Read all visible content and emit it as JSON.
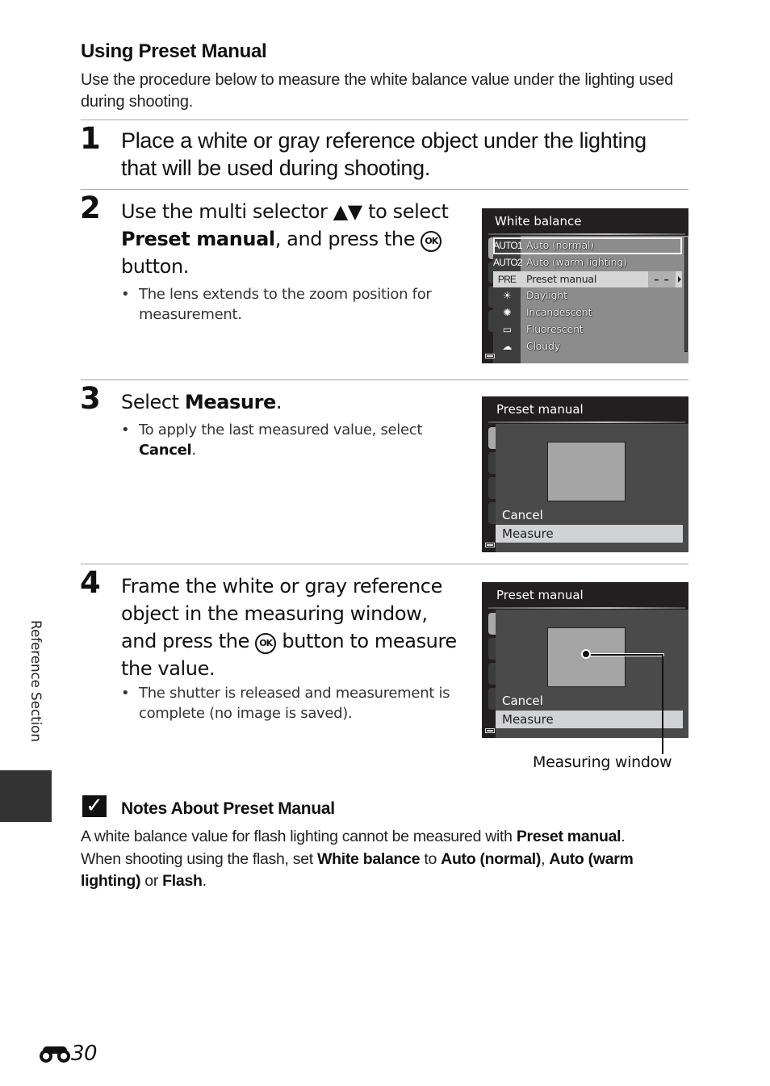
{
  "section": {
    "heading": "Using Preset Manual",
    "intro": "Use the procedure below to measure the white balance value under the lighting used during shooting."
  },
  "steps": [
    {
      "number": "1",
      "text": "Place a white or gray reference object under the lighting that will be used during shooting."
    },
    {
      "number": "2",
      "text_a": "Use the multi selector ",
      "arrows": "▲▼",
      "text_b": " to select ",
      "bold": "Preset manual",
      "text_c": ", and press the ",
      "ok_icon": "OK",
      "text_d": " button.",
      "bullet": "The lens extends to the zoom position for measurement."
    },
    {
      "number": "3",
      "text_a": "Select ",
      "bold": "Measure",
      "text_b": ".",
      "bullet_a": "To apply the last measured value, select ",
      "bullet_bold": "Cancel",
      "bullet_b": "."
    },
    {
      "number": "4",
      "text_a": "Frame the white or gray reference object in the measuring window, and press the ",
      "ok_icon": "OK",
      "text_b": " button to measure the value.",
      "bullet": "The shutter is released and measurement is complete (no image is saved)."
    }
  ],
  "screens": {
    "white_balance": {
      "title": "White balance",
      "items": [
        {
          "icon": "AUTO1",
          "label": "Auto (normal)",
          "state": "focus"
        },
        {
          "icon": "AUTO2",
          "label": "Auto (warm lighting)",
          "state": ""
        },
        {
          "icon": "PRE",
          "label": "Preset manual",
          "state": "selected",
          "value": "– –"
        },
        {
          "icon": "☀",
          "label": "Daylight",
          "state": ""
        },
        {
          "icon": "✺",
          "label": "Incandescent",
          "state": ""
        },
        {
          "icon": "▭",
          "label": "Fluorescent",
          "state": ""
        },
        {
          "icon": "☁",
          "label": "Cloudy",
          "state": ""
        }
      ]
    },
    "preset_manual_1": {
      "title": "Preset manual",
      "options": [
        "Cancel",
        "Measure"
      ],
      "selected": "Measure"
    },
    "preset_manual_2": {
      "title": "Preset manual",
      "options": [
        "Cancel",
        "Measure"
      ],
      "selected": "Measure",
      "callout": "Measuring window"
    }
  },
  "notes": {
    "icon": "check-icon",
    "title": "Notes About Preset Manual",
    "p1_a": "A white balance value for flash lighting cannot be measured with ",
    "p1_bold": "Preset manual",
    "p1_b": ".",
    "p2_a": "When shooting using the flash, set ",
    "p2_bold1": "White balance",
    "p2_b": " to ",
    "p2_bold2": "Auto (normal)",
    "p2_c": ", ",
    "p2_bold3": "Auto (warm lighting)",
    "p2_d": " or ",
    "p2_bold4": "Flash",
    "p2_e": "."
  },
  "side_tab": {
    "label": "Reference Section"
  },
  "footer": {
    "page_icon": "binoculars-icon",
    "page_number": "30"
  }
}
